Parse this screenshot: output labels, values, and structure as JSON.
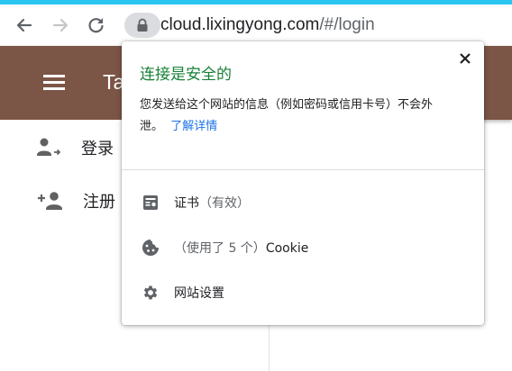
{
  "browser": {
    "url_host": "cloud.lixingyong.com",
    "url_path": "/#/login"
  },
  "app": {
    "title_partial": "Ta"
  },
  "sidebar": {
    "items": [
      {
        "label": "登录",
        "icon": "login-user-icon"
      },
      {
        "label": "注册",
        "icon": "add-user-icon"
      }
    ]
  },
  "popup": {
    "title": "连接是安全的",
    "description": "您发送给这个网站的信息（例如密码或信用卡号）不会外泄。",
    "learn_more": "了解详情",
    "certificate_label": "证书",
    "certificate_status": "（有效）",
    "cookie_count_text": "（使用了 5 个）",
    "cookie_label": "Cookie",
    "site_settings_label": "网站设置"
  },
  "colors": {
    "accent_bar": "#29c5f0",
    "app_header": "#7b5546",
    "secure_green": "#188038",
    "link_blue": "#1a73e8"
  }
}
